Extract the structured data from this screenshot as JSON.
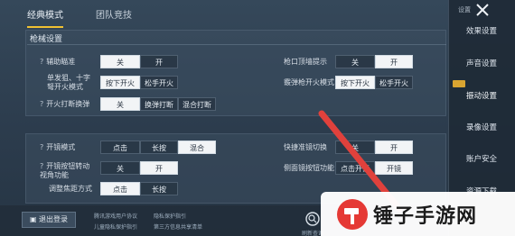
{
  "tabs": {
    "active": "经典模式",
    "second": "团队竞技"
  },
  "section": {
    "title": "枪械设置"
  },
  "rows": {
    "aim_assist": {
      "label": "辅助瞄准",
      "options": [
        "关",
        "开"
      ],
      "selected": 0
    },
    "single_fire": {
      "label": "单发狙、十字弩开火模式",
      "options": [
        "按下开火",
        "松手开火"
      ],
      "selected": 0
    },
    "fire_swap": {
      "label": "开火打断换弹",
      "options": [
        "关",
        "换弹打断",
        "混合打断"
      ],
      "selected": 0
    },
    "muzzle_hint": {
      "label": "枪口顶墙提示",
      "options": [
        "关",
        "开"
      ],
      "selected": 1
    },
    "peek_fire": {
      "label": "霰弹枪开火模式",
      "options": [
        "按下开火",
        "松手开火"
      ],
      "selected": 0
    },
    "scope_mode": {
      "label": "开镜模式",
      "options": [
        "点击",
        "长按",
        "混合"
      ],
      "selected": 2
    },
    "scope_btn_view": {
      "label": "开镜按钮转动视角功能",
      "options": [
        "关",
        "开"
      ],
      "selected": 1
    },
    "adjust_focus": {
      "label": "调整焦距方式",
      "options": [
        "点击",
        "长按"
      ],
      "selected": 0
    },
    "quick_scope": {
      "label": "快捷准镜切换",
      "options": [
        "关",
        "开"
      ],
      "selected": 0
    },
    "side_scope": {
      "label": "侧面镜按钮功能",
      "options": [
        "点击开镜",
        "开镜"
      ],
      "selected": 1
    }
  },
  "sidebar": {
    "title": "设置",
    "items": [
      "效果设置",
      "声音设置",
      "振动设置",
      "录像设置",
      "账户安全",
      "资源下载"
    ]
  },
  "bottom": {
    "logout": "退出登录",
    "links": [
      "腾讯游戏用户协议",
      "隐私保护指引",
      "儿童隐私保护指引",
      "第三方信息共享清单"
    ],
    "search_label": "刷新查询"
  },
  "watermark": {
    "text": "锤子手游网"
  },
  "colors": {
    "accent": "#f1c232",
    "selected_bg": "#f2f4f6"
  }
}
